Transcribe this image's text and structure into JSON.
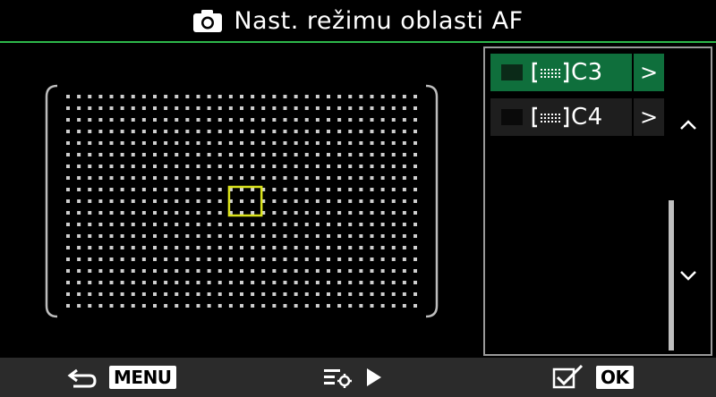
{
  "header": {
    "title": "Nast. režimu oblasti AF",
    "icon": "camera-icon",
    "accent_color": "#2db84a"
  },
  "af_area": {
    "grid_columns": 33,
    "grid_rows": 19,
    "frame_color": "#d9e21b",
    "selected_column": 16,
    "selected_row": 9
  },
  "list": {
    "items": [
      {
        "label": "C3",
        "selected": true,
        "icon": "af-target-bracket-icon",
        "arrow": ">"
      },
      {
        "label": "C4",
        "selected": false,
        "icon": "af-target-bracket-icon",
        "arrow": ">"
      }
    ],
    "selected_color": "#0f6f3c"
  },
  "footer": {
    "back_key": "MENU",
    "ok_key": "OK",
    "back_icon": "return-arrow-icon",
    "settings_icon": "settings-menu-icon",
    "play_icon": "play-triangle-icon",
    "check_icon": "checkbox-check-icon"
  }
}
